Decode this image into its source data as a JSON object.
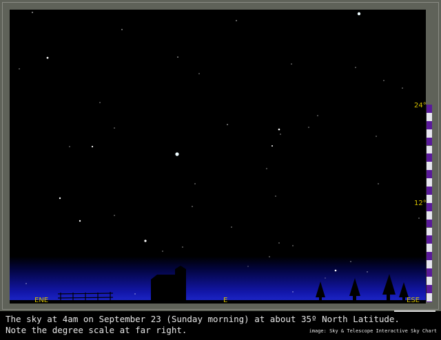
{
  "sky_chart": {
    "directions": {
      "left": "ENE",
      "center": "E",
      "right": "ESE"
    },
    "scale_labels": {
      "top": "24°",
      "mid": "12°"
    },
    "colors": {
      "horizon_blue": "#1f2ad0",
      "label_yellow": "#d9c400",
      "frame": "#5f6259",
      "scale_purple": "#5a1a9a"
    }
  },
  "caption": {
    "line1": "The sky at 4am on September 23 (Sunday morning) at about 35º North Latitude.",
    "line2": "Note the degree scale at far right.",
    "credit": "image: Sky & Telescope Interactive Sky Chart"
  }
}
